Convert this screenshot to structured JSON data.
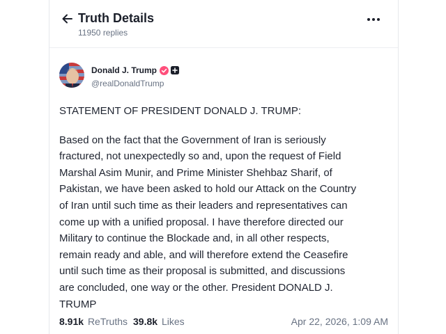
{
  "header": {
    "title": "Truth Details",
    "subtitle": "11950 replies",
    "back_icon": "arrow-left-icon",
    "more_icon": "more-horizontal-icon"
  },
  "author": {
    "name": "Donald J. Trump",
    "handle": "@realDonaldTrump",
    "verified_icon": "verified-badge-icon",
    "verified_color": "#ff4f7b",
    "plus_icon": "plus-badge-icon"
  },
  "post": {
    "heading": "STATEMENT OF PRESIDENT DONALD J. TRUMP:",
    "body_lines": [
      "Based on the fact that the Government of Iran is seriously",
      "fractured, not unexpectedly so and, upon the request of Field",
      "Marshal Asim Munir, and Prime Minister Shehbaz Sharif, of",
      "Pakistan, we have been asked to hold our Attack on the Country",
      "of Iran until such time as their leaders and representatives can",
      "come up with a unified proposal. I have therefore directed our",
      "Military to continue the Blockade and, in all other respects,",
      "remain ready and able, and will therefore extend the Ceasefire",
      "until such time as their proposal is submitted, and discussions",
      "are concluded, one way or the other. President DONALD J.",
      "TRUMP"
    ]
  },
  "stats": {
    "retruths_count": "8.91k",
    "retruths_label": "ReTruths",
    "likes_count": "39.8k",
    "likes_label": "Likes",
    "timestamp": "Apr 22, 2026, 1:09 AM"
  }
}
